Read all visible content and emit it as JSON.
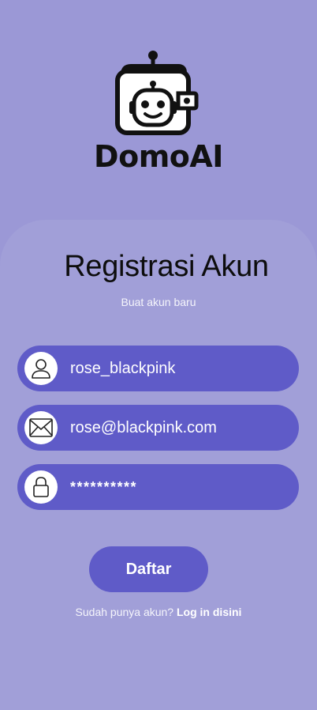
{
  "app": {
    "name": "DomoAI",
    "logo_icon": "robot-wallet-icon"
  },
  "register": {
    "title": "Registrasi Akun",
    "subtitle": "Buat akun baru"
  },
  "fields": {
    "username": {
      "value": "rose_blackpink",
      "icon": "user-icon"
    },
    "email": {
      "value": "rose@blackpink.com",
      "icon": "envelope-icon"
    },
    "password": {
      "value": "**********",
      "icon": "lock-icon"
    }
  },
  "actions": {
    "submit_label": "Daftar",
    "login_prompt": "Sudah punya akun?",
    "login_link": "Log in disini"
  },
  "colors": {
    "background": "#9b98d6",
    "card": "#a19fd8",
    "accent": "#5f5bc8",
    "text_dark": "#111111",
    "text_light": "#ffffff"
  }
}
